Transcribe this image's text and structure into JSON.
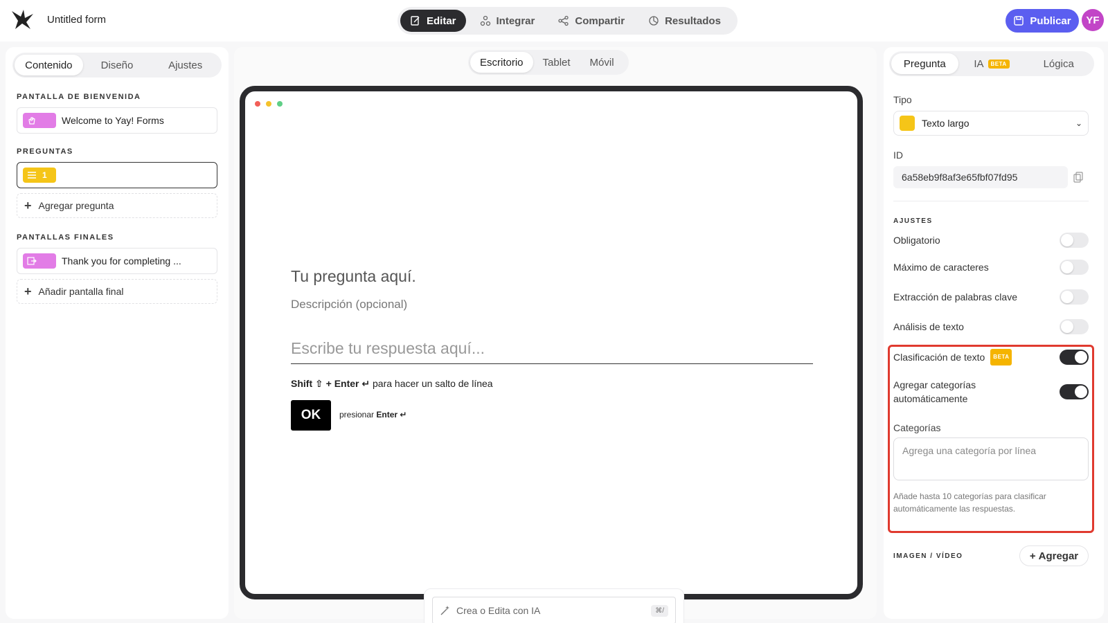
{
  "header": {
    "form_title": "Untitled form",
    "nav": [
      {
        "label": "Editar",
        "icon": "edit-icon"
      },
      {
        "label": "Integrar",
        "icon": "integrate-icon"
      },
      {
        "label": "Compartir",
        "icon": "share-icon"
      },
      {
        "label": "Resultados",
        "icon": "results-icon"
      }
    ],
    "publish_label": "Publicar",
    "avatar_initials": "YF",
    "accent_color": "#5b5ef0",
    "avatar_color": "#c245c7"
  },
  "left": {
    "tabs": [
      "Contenido",
      "Diseño",
      "Ajustes"
    ],
    "welcome_label": "PANTALLA DE BIENVENIDA",
    "welcome_item": "Welcome to Yay! Forms",
    "questions_label": "PREGUNTAS",
    "question_number": "1",
    "add_question": "Agregar pregunta",
    "endings_label": "PANTALLAS FINALES",
    "ending_item": "Thank you for completing ...",
    "add_ending": "Añadir pantalla final"
  },
  "center": {
    "devices": [
      "Escritorio",
      "Tablet",
      "Móvil"
    ],
    "question_title": "Tu pregunta aquí.",
    "question_description": "Descripción (opcional)",
    "answer_placeholder": "Escribe tu respuesta aquí...",
    "shift_hint": {
      "shift": "Shift ⇧",
      "plus_enter": "+ Enter ↵",
      "rest": "para hacer un salto de línea"
    },
    "ok_label": "OK",
    "press_hint": {
      "press": "presionar",
      "enter": "Enter ↵"
    },
    "ai_placeholder": "Crea o Edita con IA",
    "ai_shortcut": "⌘/"
  },
  "right": {
    "tabs": [
      "Pregunta",
      "IA",
      "Lógica"
    ],
    "beta": "BETA",
    "tipo_label": "Tipo",
    "tipo_value": "Texto largo",
    "id_label": "ID",
    "id_value": "6a58eb9f8af3e65fbf07fd95",
    "ajustes_label": "AJUSTES",
    "toggles": [
      {
        "label": "Obligatorio",
        "on": false
      },
      {
        "label": "Máximo de caracteres",
        "on": false
      },
      {
        "label": "Extracción de palabras clave",
        "on": false
      },
      {
        "label": "Análisis de texto",
        "on": false
      },
      {
        "label": "Clasificación de texto",
        "on": true
      },
      {
        "label": "Agregar categorías automáticamente",
        "on": true
      }
    ],
    "categories_label": "Categorías",
    "categories_placeholder": "Agrega una categoría por línea",
    "categories_help": "Añade hasta 10 categorías para clasificar automáticamente las respuestas.",
    "image_video_label": "IMAGEN / VÍDEO",
    "add_label": "Agregar",
    "highlight_color": "#e03a2f"
  }
}
